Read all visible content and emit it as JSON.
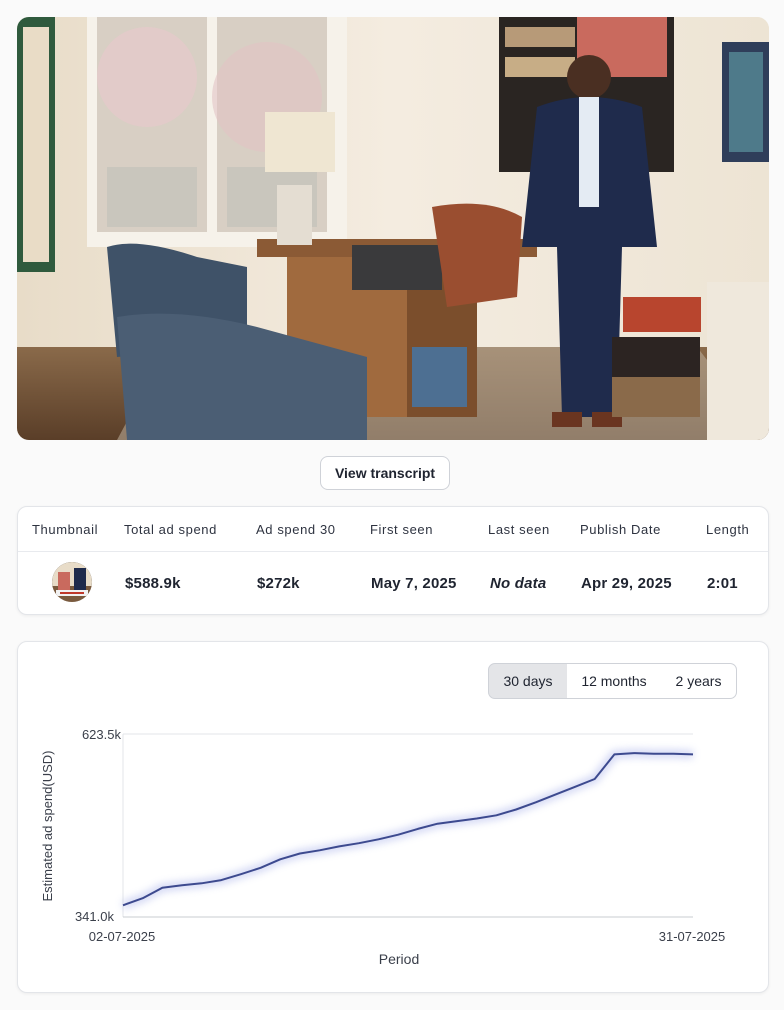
{
  "transcript_button": "View transcript",
  "table": {
    "headers": [
      "Thumbnail",
      "Total ad spend",
      "Ad spend 30",
      "First seen",
      "Last seen",
      "Publish Date",
      "Length"
    ],
    "row": {
      "total_ad_spend": "$588.9k",
      "ad_spend_30": "$272k",
      "first_seen": "May 7, 2025",
      "last_seen": "No data",
      "publish_date": "Apr 29, 2025",
      "length": "2:01"
    }
  },
  "range_tabs": [
    "30 days",
    "12 months",
    "2 years"
  ],
  "selected_range": "30 days",
  "chart_data": {
    "type": "line",
    "ylabel": "Estimated ad spend(USD)",
    "xlabel": "Period",
    "x_ticks": [
      "02-07-2025",
      "31-07-2025"
    ],
    "y_ticks": [
      "623.5k",
      "341.0k"
    ],
    "ylim": [
      341.0,
      623.5
    ],
    "x": [
      "02-07-2025",
      "03-07-2025",
      "04-07-2025",
      "05-07-2025",
      "06-07-2025",
      "07-07-2025",
      "08-07-2025",
      "09-07-2025",
      "10-07-2025",
      "11-07-2025",
      "12-07-2025",
      "13-07-2025",
      "14-07-2025",
      "15-07-2025",
      "16-07-2025",
      "17-07-2025",
      "18-07-2025",
      "19-07-2025",
      "20-07-2025",
      "21-07-2025",
      "22-07-2025",
      "23-07-2025",
      "24-07-2025",
      "25-07-2025",
      "26-07-2025",
      "27-07-2025",
      "28-07-2025",
      "29-07-2025",
      "30-07-2025",
      "31-07-2025"
    ],
    "series": [
      {
        "values": [
          359,
          370,
          386,
          390,
          393,
          398,
          407,
          417,
          430,
          439,
          444,
          450,
          455,
          461,
          468,
          477,
          485,
          489,
          493,
          498,
          507,
          518,
          530,
          542,
          554,
          592,
          594,
          593,
          593,
          592
        ],
        "color": "#3d4a8f"
      }
    ],
    "grid": true
  }
}
